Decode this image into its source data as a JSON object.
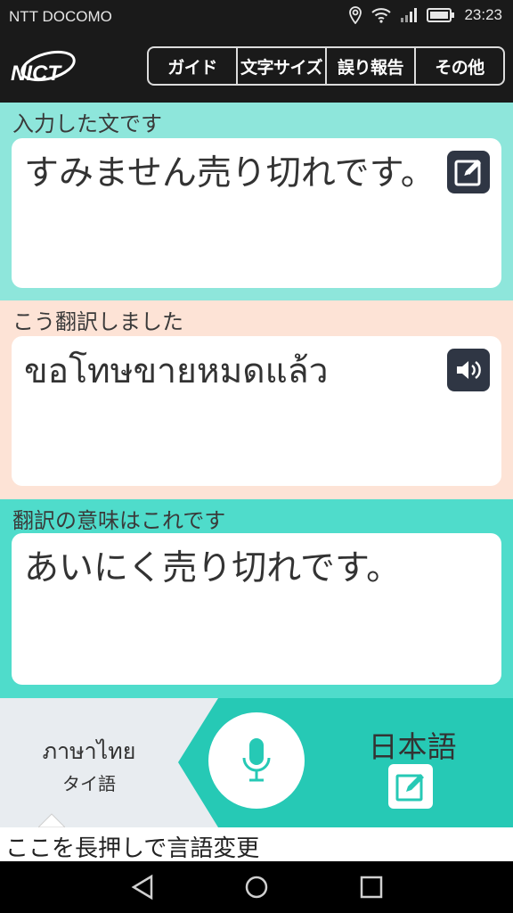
{
  "status_bar": {
    "carrier": "NTT DOCOMO",
    "time": "23:23",
    "icons": [
      "location-icon",
      "wifi-icon",
      "signal-icon",
      "battery-icon"
    ]
  },
  "app_bar": {
    "logo_text": "NICT",
    "menu": [
      {
        "label": "ガイド"
      },
      {
        "label": "文字サイズ"
      },
      {
        "label": "誤り報告"
      },
      {
        "label": "その他"
      }
    ]
  },
  "input_section": {
    "label": "入力した文です",
    "text": "すみません売り切れです。",
    "bg_color": "#8ee6db",
    "icon": "edit-icon"
  },
  "translation_section": {
    "label": "こう翻訳しました",
    "text": "ขอโทษขายหมดแล้ว",
    "bg_color": "#fde3d6",
    "icon": "speaker-icon"
  },
  "backtranslation_section": {
    "label": "翻訳の意味はこれです",
    "text": "あいにく売り切れです。",
    "bg_color": "#4fdccb"
  },
  "bottom_bar": {
    "source_lang_native": "ภาษาไทย",
    "source_lang_jp": "タイ語",
    "target_lang": "日本語",
    "mic_icon": "microphone-icon",
    "target_edit_icon": "edit-icon",
    "accent_color": "#26c9b5"
  },
  "hint": {
    "text": "ここを長押しで言語変更"
  },
  "nav_bar": {
    "icons": [
      "back-icon",
      "home-icon",
      "recents-icon"
    ]
  }
}
